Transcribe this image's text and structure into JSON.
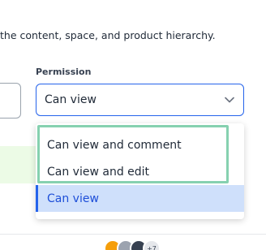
{
  "hint_text": " the content, space, and product hierarchy.",
  "permission": {
    "label": "Permission",
    "selected_value": "Can view",
    "options": [
      {
        "label": "Can view and comment",
        "selected": false
      },
      {
        "label": "Can view and edit",
        "selected": false
      },
      {
        "label": "Can view",
        "selected": true
      }
    ]
  },
  "avatars": {
    "count_label": "+7"
  },
  "colors": {
    "accent": "#2563eb",
    "selected_bg": "#cfe0fb",
    "highlight_border": "#86d1b0"
  }
}
